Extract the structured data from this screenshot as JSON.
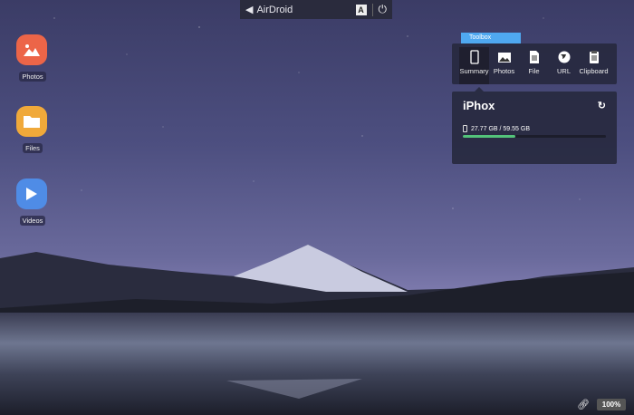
{
  "topbar": {
    "brand": "AirDroid",
    "lang_label": "A"
  },
  "desktop": [
    {
      "label": "Photos",
      "color": "#ec6548"
    },
    {
      "label": "Files",
      "color": "#f0a93a"
    },
    {
      "label": "Videos",
      "color": "#4f8ce6"
    }
  ],
  "toolbox": {
    "tag": "Toolbox",
    "tools": [
      {
        "label": "Summary"
      },
      {
        "label": "Photos"
      },
      {
        "label": "File"
      },
      {
        "label": "URL"
      },
      {
        "label": "Clipboard"
      }
    ]
  },
  "device": {
    "name": "iPhox",
    "storage_text": "27.77 GB / 59.55 GB",
    "storage_fill_fraction": 0.37
  },
  "footer": {
    "zoom": "100%"
  },
  "colors": {
    "accent": "#4fa8f0",
    "storage": "#53c37a"
  }
}
